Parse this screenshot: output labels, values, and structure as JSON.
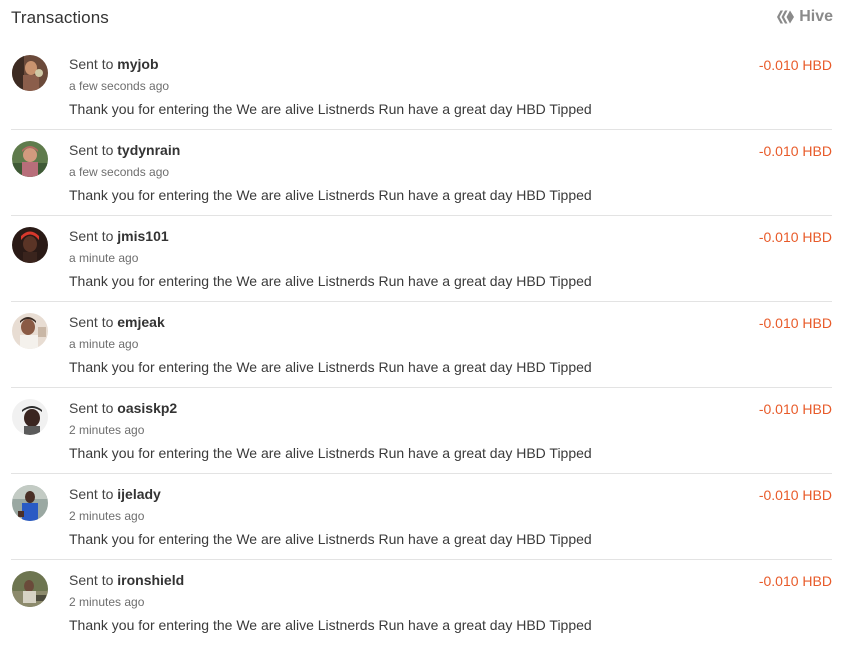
{
  "header": {
    "title": "Transactions",
    "chain_label": "Hive",
    "chain_icon": "hive-logo-icon"
  },
  "colors": {
    "amount": "#e85b2a",
    "divider": "#e3e3e3",
    "muted": "#6e6e6e"
  },
  "transactions": [
    {
      "prefix": "Sent to ",
      "recipient": "myjob",
      "time": "a few seconds ago",
      "memo": "Thank you for entering the We are alive Listnerds Run have a great day HBD Tipped",
      "amount": "-0.010 HBD"
    },
    {
      "prefix": "Sent to ",
      "recipient": "tydynrain",
      "time": "a few seconds ago",
      "memo": "Thank you for entering the We are alive Listnerds Run have a great day HBD Tipped",
      "amount": "-0.010 HBD"
    },
    {
      "prefix": "Sent to ",
      "recipient": "jmis101",
      "time": "a minute ago",
      "memo": "Thank you for entering the We are alive Listnerds Run have a great day HBD Tipped",
      "amount": "-0.010 HBD"
    },
    {
      "prefix": "Sent to ",
      "recipient": "emjeak",
      "time": "a minute ago",
      "memo": "Thank you for entering the We are alive Listnerds Run have a great day HBD Tipped",
      "amount": "-0.010 HBD"
    },
    {
      "prefix": "Sent to ",
      "recipient": "oasiskp2",
      "time": "2 minutes ago",
      "memo": "Thank you for entering the We are alive Listnerds Run have a great day HBD Tipped",
      "amount": "-0.010 HBD"
    },
    {
      "prefix": "Sent to ",
      "recipient": "ijelady",
      "time": "2 minutes ago",
      "memo": "Thank you for entering the We are alive Listnerds Run have a great day HBD Tipped",
      "amount": "-0.010 HBD"
    },
    {
      "prefix": "Sent to ",
      "recipient": "ironshield",
      "time": "2 minutes ago",
      "memo": "Thank you for entering the We are alive Listnerds Run have a great day HBD Tipped",
      "amount": "-0.010 HBD"
    }
  ]
}
